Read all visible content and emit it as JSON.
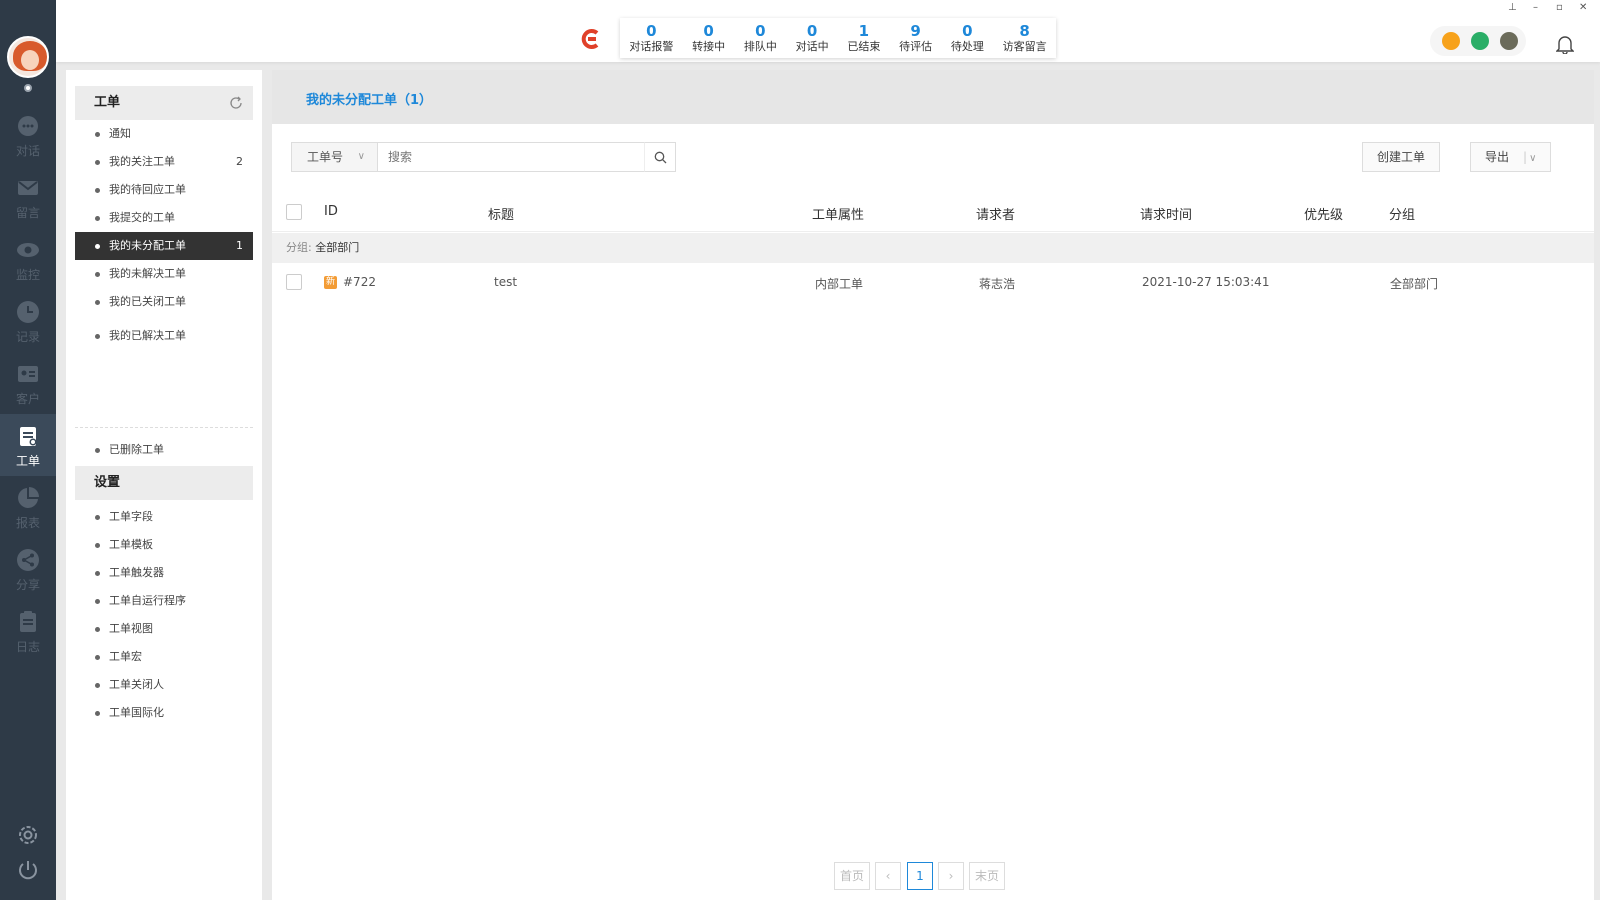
{
  "window": {
    "pin": "⊥",
    "minimize": "–",
    "restore": "▫",
    "close": "✕"
  },
  "rail": {
    "items": [
      {
        "label": "对话",
        "icon": "chat-icon"
      },
      {
        "label": "留言",
        "icon": "mail-icon"
      },
      {
        "label": "监控",
        "icon": "eye-icon"
      },
      {
        "label": "记录",
        "icon": "clock-icon"
      },
      {
        "label": "客户",
        "icon": "contact-card-icon"
      },
      {
        "label": "工单",
        "icon": "ticket-icon"
      },
      {
        "label": "报表",
        "icon": "pie-chart-icon"
      },
      {
        "label": "分享",
        "icon": "share-icon"
      },
      {
        "label": "日志",
        "icon": "clipboard-icon"
      }
    ],
    "active": "工单"
  },
  "stats": [
    {
      "value": "0",
      "label": "对话报警"
    },
    {
      "value": "0",
      "label": "转接中"
    },
    {
      "value": "0",
      "label": "排队中"
    },
    {
      "value": "0",
      "label": "对话中"
    },
    {
      "value": "1",
      "label": "已结束"
    },
    {
      "value": "9",
      "label": "待评估"
    },
    {
      "value": "0",
      "label": "待处理"
    },
    {
      "value": "8",
      "label": "访客留言"
    }
  ],
  "sidebar": {
    "ticket_header": "工单",
    "ticket_items": [
      {
        "label": "通知",
        "count": ""
      },
      {
        "label": "我的关注工单",
        "count": "2"
      },
      {
        "label": "我的待回应工单",
        "count": ""
      },
      {
        "label": "我提交的工单",
        "count": ""
      },
      {
        "label": "我的未分配工单",
        "count": "1"
      },
      {
        "label": "我的未解决工单",
        "count": ""
      },
      {
        "label": "我的已关闭工单",
        "count": ""
      },
      {
        "label": "我的已解决工单",
        "count": ""
      }
    ],
    "deleted": "已删除工单",
    "settings_header": "设置",
    "settings_items": [
      "工单字段",
      "工单模板",
      "工单触发器",
      "工单自运行程序",
      "工单视图",
      "工单宏",
      "工单关闭人",
      "工单国际化"
    ]
  },
  "main": {
    "title": "我的未分配工单（1）",
    "filter_select": "工单号",
    "search_placeholder": "搜索",
    "create_button": "创建工单",
    "export_button": "导出",
    "columns": [
      "ID",
      "标题",
      "工单属性",
      "请求者",
      "请求时间",
      "优先级",
      "分组"
    ],
    "group_label": "分组:",
    "group_value": "全部部门",
    "rows": [
      {
        "badge": "新",
        "id": "#722",
        "title": "test",
        "attr": "内部工单",
        "requester": "蒋志浩",
        "time": "2021-10-27 15:03:41",
        "priority": "",
        "group": "全部部门"
      }
    ],
    "pager": {
      "first": "首页",
      "prev": "‹",
      "current": "1",
      "next": "›",
      "last": "末页"
    }
  },
  "colors": {
    "accent": "#1e88d9",
    "rail_bg": "#2e3a47",
    "badge": "#f39c35"
  }
}
